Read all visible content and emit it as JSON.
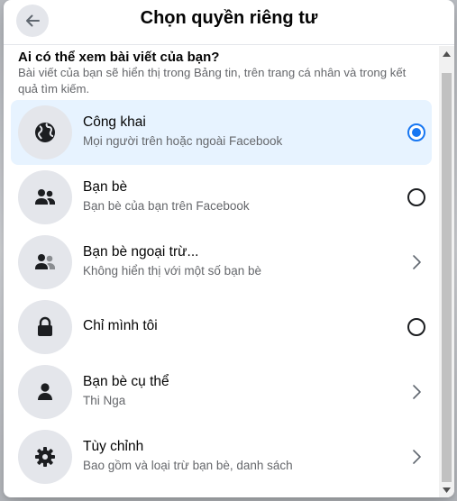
{
  "dialog": {
    "title": "Chọn quyền riêng tư",
    "question": "Ai có thể xem bài viết của bạn?",
    "description": "Bài viết của bạn sẽ hiển thị trong Bảng tin, trên trang cá nhân và trong kết quả tìm kiếm."
  },
  "options": [
    {
      "icon": "globe-icon",
      "title": "Công khai",
      "subtitle": "Mọi người trên hoặc ngoài Facebook",
      "control": "radio",
      "selected": true
    },
    {
      "icon": "friends-icon",
      "title": "Bạn bè",
      "subtitle": "Bạn bè của bạn trên Facebook",
      "control": "radio",
      "selected": false
    },
    {
      "icon": "friends-except-icon",
      "title": "Bạn bè ngoại trừ...",
      "subtitle": "Không hiển thị với một số bạn bè",
      "control": "chevron",
      "selected": false
    },
    {
      "icon": "lock-icon",
      "title": "Chỉ mình tôi",
      "subtitle": "",
      "control": "radio",
      "selected": false
    },
    {
      "icon": "person-icon",
      "title": "Bạn bè cụ thể",
      "subtitle": "Thi Nga",
      "control": "chevron",
      "selected": false
    },
    {
      "icon": "gear-icon",
      "title": "Tùy chỉnh",
      "subtitle": "Bao gồm và loại trừ bạn bè, danh sách",
      "control": "chevron",
      "selected": false
    }
  ],
  "colors": {
    "accent": "#1877f2",
    "selected_bg": "#e7f3ff",
    "icon_bg": "#e4e6eb"
  }
}
